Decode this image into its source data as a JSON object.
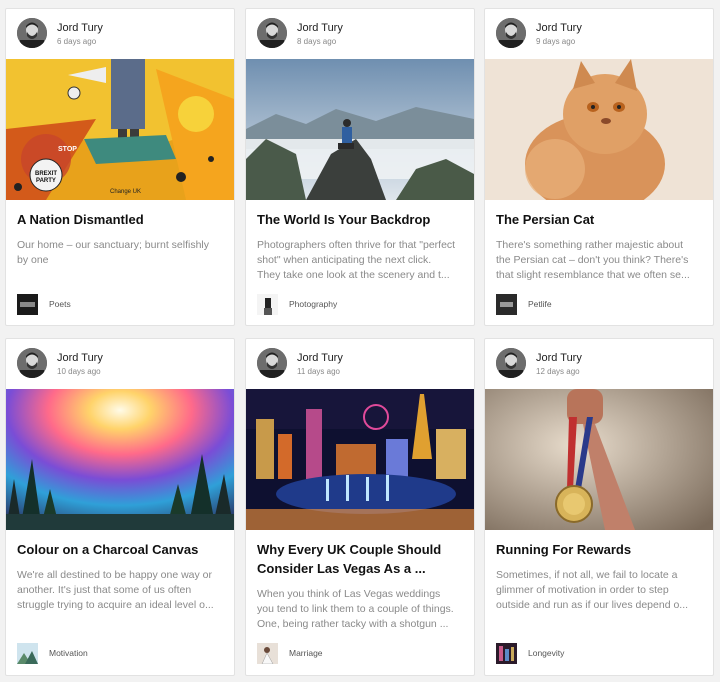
{
  "posts": [
    {
      "author": "Jord Tury",
      "ago": "6 days ago",
      "image": "protest-collage-image",
      "title_lines": [
        "A Nation Dismantled"
      ],
      "excerpt_lines": [
        "Our home – our sanctuary; burnt selfishly",
        "by one"
      ],
      "category": "Poets",
      "cover_text": [
        "BREXIT",
        "PARTY",
        "Change UK",
        "STOP"
      ]
    },
    {
      "author": "Jord Tury",
      "ago": "8 days ago",
      "image": "photographer-on-cliff-image",
      "title_lines": [
        "The World Is Your Backdrop"
      ],
      "excerpt_lines": [
        "Photographers often thrive for that \"perfect",
        "shot\" when anticipating the next click.",
        "They take one look at the scenery and t..."
      ],
      "category": "Photography"
    },
    {
      "author": "Jord Tury",
      "ago": "9 days ago",
      "image": "persian-cat-image",
      "title_lines": [
        "The Persian Cat"
      ],
      "excerpt_lines": [
        "There's something rather majestic about",
        "the Persian cat – don't you think? There's",
        "that slight resemblance that we often se..."
      ],
      "category": "Petlife"
    },
    {
      "author": "Jord Tury",
      "ago": "10 days ago",
      "image": "rainbow-forest-painting-image",
      "title_lines": [
        "Colour on a Charcoal Canvas"
      ],
      "excerpt_lines": [
        "We're all destined to be happy one way or",
        "another. It's just that some of us often",
        "struggle trying to acquire an ideal level o..."
      ],
      "category": "Motivation"
    },
    {
      "author": "Jord Tury",
      "ago": "11 days ago",
      "image": "las-vegas-night-image",
      "title_lines": [
        "Why Every UK Couple Should",
        "Consider Las Vegas As a ..."
      ],
      "excerpt_lines": [
        "When you think of Las Vegas weddings",
        "you tend to link them to a couple of things.",
        "One, being rather tacky with a shotgun ..."
      ],
      "category": "Marriage"
    },
    {
      "author": "Jord Tury",
      "ago": "12 days ago",
      "image": "medal-fist-image",
      "title_lines": [
        "Running For Rewards"
      ],
      "excerpt_lines": [
        "Sometimes, if not all, we fail to locate a",
        "glimmer of motivation in order to step",
        "outside and run as if our lives depend o..."
      ],
      "category": "Longevity"
    }
  ],
  "colors": {
    "background": "#f2f2f2",
    "card": "#ffffff",
    "title": "#111111",
    "excerpt": "#8a8a8a",
    "meta": "#888888"
  }
}
